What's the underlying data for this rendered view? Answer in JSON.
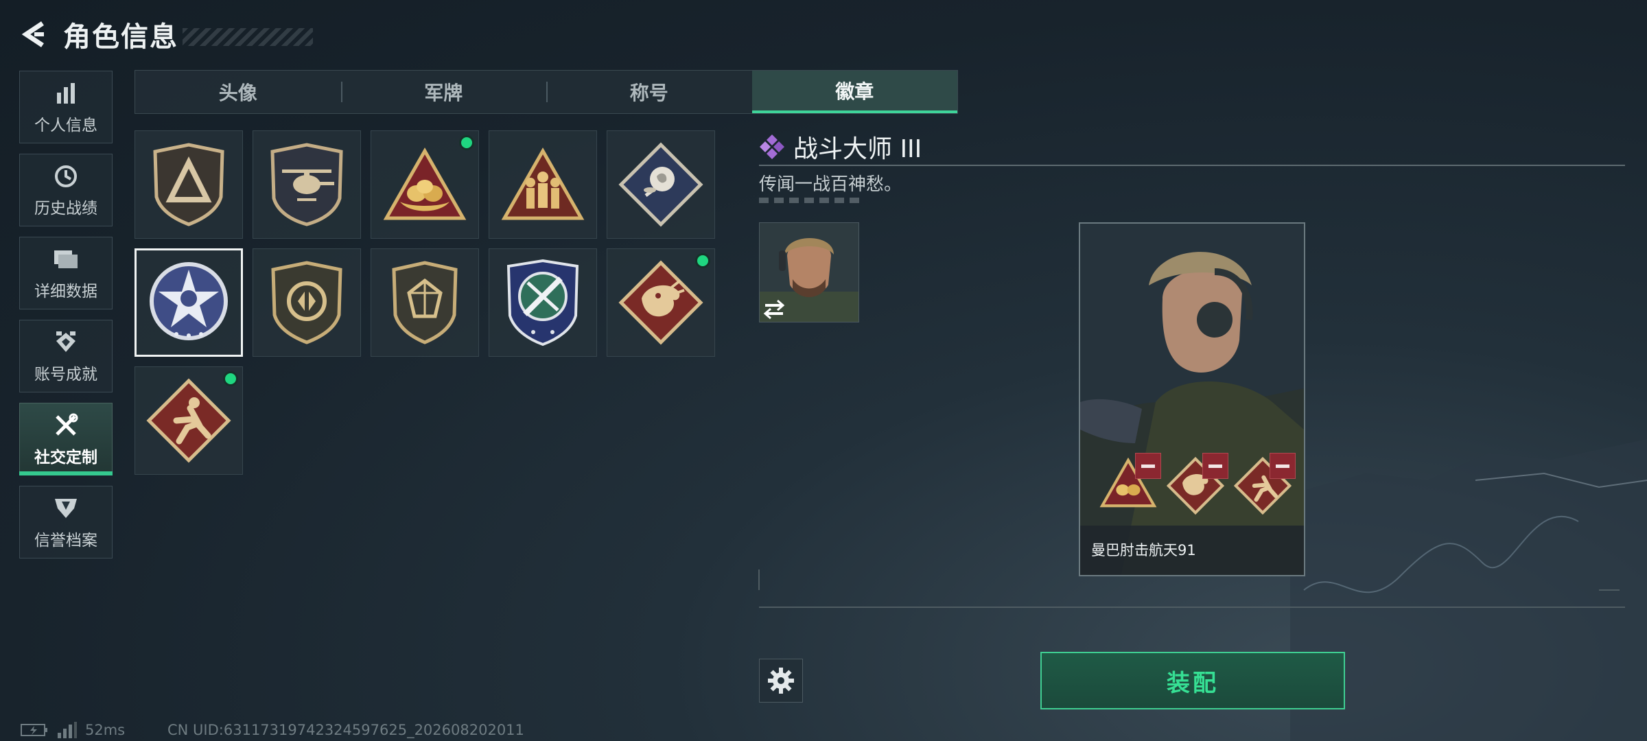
{
  "header": {
    "title": "角色信息"
  },
  "sidenav": {
    "items": [
      {
        "label": "个人信息",
        "icon": "bar-chart-icon"
      },
      {
        "label": "历史战绩",
        "icon": "clock-icon"
      },
      {
        "label": "详细数据",
        "icon": "folder-icon"
      },
      {
        "label": "账号成就",
        "icon": "achievement-icon"
      },
      {
        "label": "社交定制",
        "icon": "wrench-screwdriver-icon"
      },
      {
        "label": "信誉档案",
        "icon": "shield-icon"
      }
    ],
    "active_index": 4
  },
  "tabs": [
    "头像",
    "军牌",
    "称号",
    "徽章"
  ],
  "active_tab": "徽章",
  "badges": [
    {
      "icon": "triangle-shield-badge",
      "new": false
    },
    {
      "icon": "helicopter-badge",
      "new": false
    },
    {
      "icon": "gold-nest-badge",
      "new": true
    },
    {
      "icon": "squad-badge",
      "new": false
    },
    {
      "icon": "rose-badge",
      "new": false
    },
    {
      "icon": "skull-star-badge",
      "new": false,
      "selected": true
    },
    {
      "icon": "bronze-shield-badge",
      "new": false
    },
    {
      "icon": "gem-shield-badge",
      "new": false
    },
    {
      "icon": "crossed-blades-badge",
      "new": false
    },
    {
      "icon": "dragon-badge",
      "new": true
    },
    {
      "icon": "runner-badge",
      "new": true
    }
  ],
  "detail": {
    "title": "战斗大师 III",
    "description": "传闻一战百神愁。",
    "rarity_color": "#a36cd6"
  },
  "character": {
    "name": "曼巴肘击航天91"
  },
  "equip_button": "装配",
  "status": {
    "ping": "52ms",
    "uid": "CN UID:63117319742324597625_202608202011"
  },
  "colors": {
    "accent": "#3fd49a",
    "remove": "#8b2730"
  }
}
